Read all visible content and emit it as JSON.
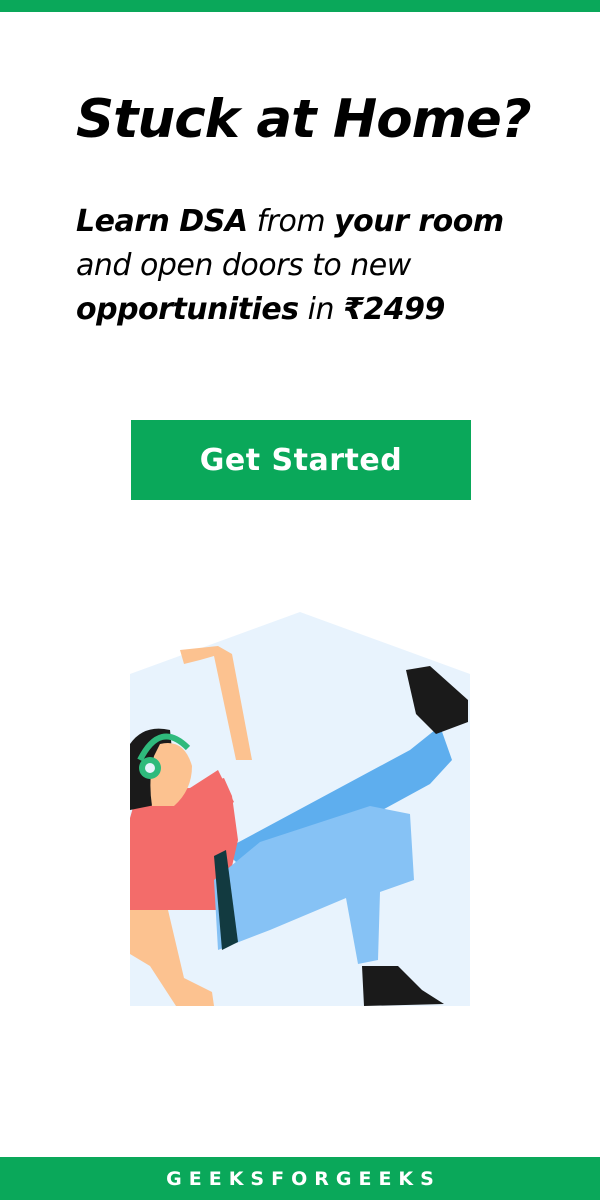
{
  "headline": "Stuck at Home?",
  "tagline": {
    "line1": {
      "bold1": "Learn DSA",
      "text1": " from ",
      "bold2": "your room"
    },
    "line2": {
      "text": "and open doors to new"
    },
    "line3": {
      "bold": "opportunities",
      "text": " in ",
      "price": "₹2499"
    }
  },
  "cta": {
    "label": "Get Started"
  },
  "footer": {
    "brand": "GEEKSFORGEEKS"
  },
  "colors": {
    "brand_green": "#0aa85a",
    "house_bg": "#e8f3fd",
    "shirt": "#f36c6a",
    "pants": "#86c2f5",
    "skin": "#fcc290",
    "headphones": "#2fba7c"
  }
}
